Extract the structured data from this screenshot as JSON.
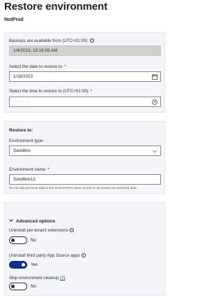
{
  "header": {
    "title": "Restore environment",
    "subtitle": "NotProd"
  },
  "backup": {
    "available_label": "Backups are available from (UTC+01:00):",
    "available_value": "1/4/2023, 10:16:09 AM",
    "date_label": "Select the date to restore to: *",
    "date_value": "1/18/2023",
    "time_label": "Select the time to restore to (UTC+01:00): *",
    "time_placeholder": "--:-- --"
  },
  "restore_to": {
    "heading": "Restore to:",
    "env_type_label": "Environment type:",
    "env_type_value": "Sandbox",
    "env_name_label": "Environment name: *",
    "env_name_value": "Sandbox12",
    "env_name_helper": "Do not add personal data to the environment name as this is not treated as restricted data."
  },
  "advanced": {
    "heading": "Advanced options",
    "uninstall_ext_label": "Uninstall per-tenant extensions",
    "uninstall_ext_state": "No",
    "uninstall_apps_label": "Uninstall third party App Source apps",
    "uninstall_apps_state": "Yes",
    "skip_cleanup_label": "Skip environment cleanup",
    "skip_cleanup_link": "(?)",
    "skip_cleanup_state": "No"
  },
  "icons": {
    "info": "info-icon",
    "calendar": "calendar-icon",
    "clock": "clock-icon",
    "dropdown": "chevron-down-icon",
    "collapse": "chevron-down-icon"
  },
  "colors": {
    "toggle_on": "#0f2d8c",
    "panel_bg": "#f3f5fa",
    "link": "#1f3a93"
  }
}
